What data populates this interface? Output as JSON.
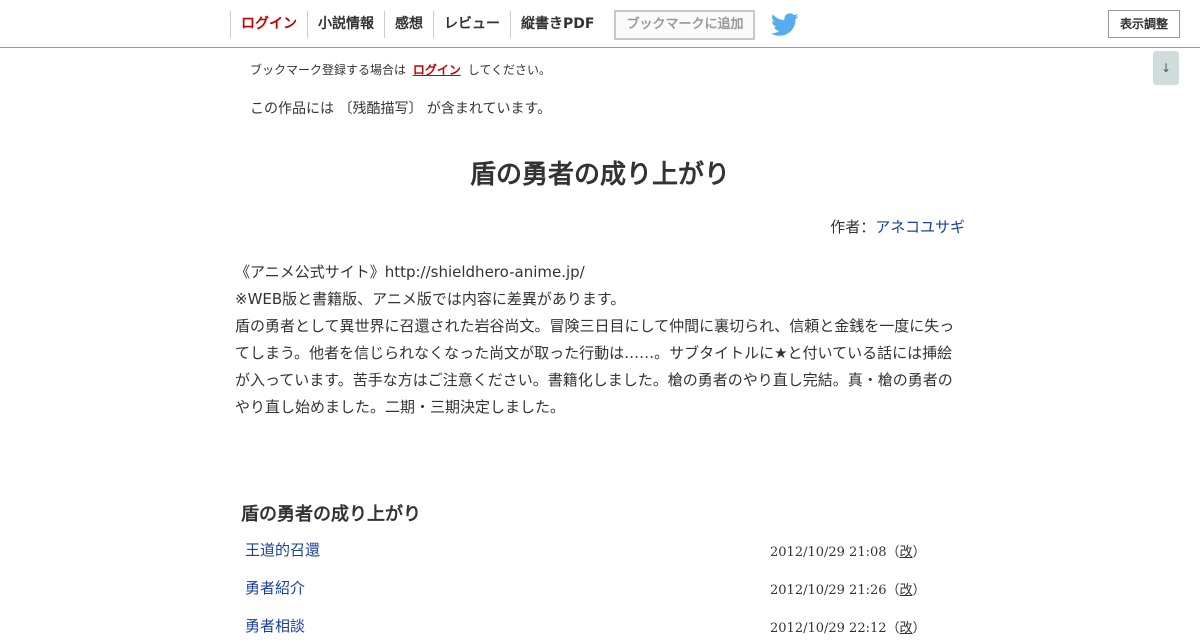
{
  "nav": {
    "items": [
      {
        "label": "ログイン",
        "name": "nav-login"
      },
      {
        "label": "小説情報",
        "name": "nav-novel-info"
      },
      {
        "label": "感想",
        "name": "nav-impressions"
      },
      {
        "label": "レビュー",
        "name": "nav-review"
      },
      {
        "label": "縦書きPDF",
        "name": "nav-vertical-pdf"
      }
    ],
    "bookmark_button": "ブックマークに追加",
    "display_button": "表示調整",
    "scroll_button": "↓",
    "twitter_icon": "twitter-bird-icon"
  },
  "notice": {
    "prefix": "ブックマーク登録する場合は",
    "login_link": "ログイン",
    "suffix": "してください。"
  },
  "warning": "この作品には 〔残酷描写〕 が含まれています。",
  "novel": {
    "title": "盾の勇者の成り上がり",
    "author_prefix": "作者：",
    "author": "アネコユサギ"
  },
  "synopsis": [
    "《アニメ公式サイト》http://shieldhero-anime.jp/",
    "※WEB版と書籍版、アニメ版では内容に差異があります。",
    "盾の勇者として異世界に召還された岩谷尚文。冒険三日目にして仲間に裏切られ、信頼と金銭を一度に失っ",
    "てしまう。他者を信じられなくなった尚文が取った行動は……。サブタイトルに★と付いている話には挿絵",
    "が入っています。苦手な方はご注意ください。書籍化しました。槍の勇者のやり直し完結。真・槍の勇者の",
    "やり直し始めました。二期・三期決定しました。"
  ],
  "chapter": {
    "title": "盾の勇者の成り上がり",
    "episodes": [
      {
        "title": "王道的召還",
        "date": "2012/10/29 21:08",
        "kai_open": "（",
        "kai": "改",
        "kai_close": "）"
      },
      {
        "title": "勇者紹介",
        "date": "2012/10/29 21:26",
        "kai_open": "（",
        "kai": "改",
        "kai_close": "）"
      },
      {
        "title": "勇者相談",
        "date": "2012/10/29 22:12",
        "kai_open": "（",
        "kai": "改",
        "kai_close": "）"
      }
    ]
  },
  "colors": {
    "login_red": "#c40000",
    "link_blue": "#1a3fa3",
    "twitter_blue": "#55acee"
  }
}
